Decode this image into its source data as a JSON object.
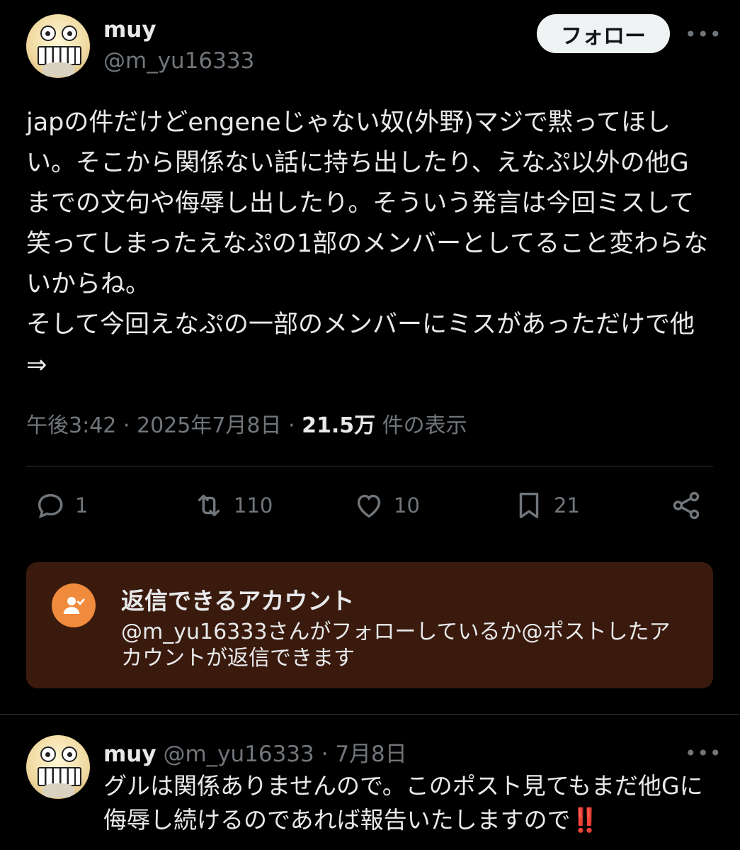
{
  "post": {
    "display_name": "muy",
    "handle": "@m_yu16333",
    "follow_label": "フォロー",
    "more_label": "•••",
    "text": "japの件だけどengeneじゃない奴(外野)マジで黙ってほしい。そこから関係ない話に持ち出したり、えなぷ以外の他Gまでの文句や侮辱し出したり。そういう発言は今回ミスして笑ってしまったえなぷの1部のメンバーとしてること変わらないからね。\nそして今回えなぷの一部のメンバーにミスがあっただけで他⇒",
    "time": "午後3:42 · 2025年7月8日 · ",
    "views_count": "21.5万",
    "views_suffix": " 件の表示"
  },
  "actions": {
    "reply_count": "1",
    "repost_count": "110",
    "like_count": "10",
    "bookmark_count": "21"
  },
  "notice": {
    "title": "返信できるアカウント",
    "description": "@m_yu16333さんがフォローしているか@ポストしたアカウントが返信できます"
  },
  "reply": {
    "display_name": "muy",
    "handle": " @m_yu16333 · 7月8日",
    "more_label": "•••",
    "text": "グルは関係ありませんので。このポスト見てもまだ他Gに侮辱し続けるのであれば報告いたしますので",
    "emphasis": "‼️"
  },
  "colors": {
    "background": "#000000",
    "text": "#e7e9ea",
    "muted": "#71767b",
    "notice_bg": "#3a1a0d",
    "notice_icon": "#f08a3c"
  }
}
